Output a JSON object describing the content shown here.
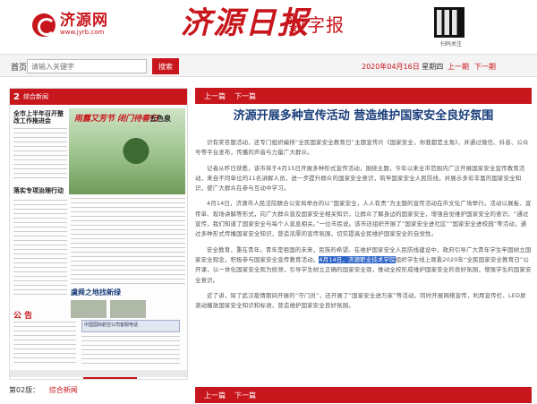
{
  "header": {
    "logo_name": "济源网",
    "logo_url": "www.jyrb.com",
    "masthead": "济源日报",
    "edition": "数字报",
    "qr_caption": "扫码关注"
  },
  "search": {
    "home_label": "首页",
    "placeholder": "请输入关键字",
    "button_label": "搜索"
  },
  "date_bar": {
    "date": "2020年04月16日",
    "weekday": "星期四",
    "prev_label": "上一期",
    "next_label": "下一期"
  },
  "page_thumb": {
    "page_number": "2",
    "section": "综合新闻",
    "stamp": "雨露又芳节 闭门待春归",
    "seal": "五色泉",
    "title_a": "全市上半年召开整改工作推进会",
    "title_b": "落实专项治理行动",
    "notice": "公 告",
    "footer": "虞舜之地找新绿",
    "blue_note": "中国国际航空公司客服电话"
  },
  "page_label": {
    "text": "第02版：",
    "section": "综合新闻"
  },
  "article": {
    "prev_label": "上一篇",
    "next_label": "下一篇",
    "title": "济源开展多种宣传活动 营造维护国家安全良好氛围",
    "p1": "识有奖答题活动，还专门组织编排“全民国家安全教育日”主题宣传片《国家安全，你我都是主角》，并通过微信、抖音、公众号等平台发布，传播的声音与力量广大群众。",
    "p2": "记者从昨日获悉，该市将于4月15日开展多种形式宣传活动，围绕主题，今年以来全市范围内广泛开展国家安全宣传教育活动，来自不同单位的11名讲解人员，进一步提升群众的国家安全意识，筑牢国家安全人民防线，并展示多彩丰富的国家安全知识，使广大群众在参与互动中学习。",
    "p3": "4月14日，济源市人民法院联合公安局举办的以“国家安全，人人有责”为主题的宣传活动在市文化广场举行。活动以展板、宣传单、现场讲解等形式，向广大群众普及国家安全相关知识，让群众了解身边的国家安全，增强自觉维护国家安全的意识。“通过宣传，我们知道了国家安全与每个人息息相关。”一位市民说。该市还组织开展了“国家安全进社区”“国家安全进校园”等活动，通过多种形式传播国家安全知识，营造浓厚的宣传氛围，切实提高全民维护国家安全的自觉性。",
    "p4": "安全教育，重在青年。青年是祖国的未来，民族的希望。在维护国家安全人民防线建设中，政府引导广大青年学生牢固树立国家安全观念，积极参与国家安全宣传教育活动。",
    "highlight": "4月14日，济源职业技术学院",
    "p4b": "组织学生线上观看2020年“全民国家安全教育日”公开课，以一体化国家安全观为统领，引导学生树立正确的国家安全观，推动全校形成维护国家安全的良好氛围，增强学生的国家安全意识。",
    "p5": "近了讲，除了武汉疫情期间开展的“守门员”，还开展了“国家安全进万家”等活动，同时开展网络宣传，利用宣传栏、LED屏滚动播放国家安全知识和标语，营造维护国家安全良好氛围。"
  }
}
